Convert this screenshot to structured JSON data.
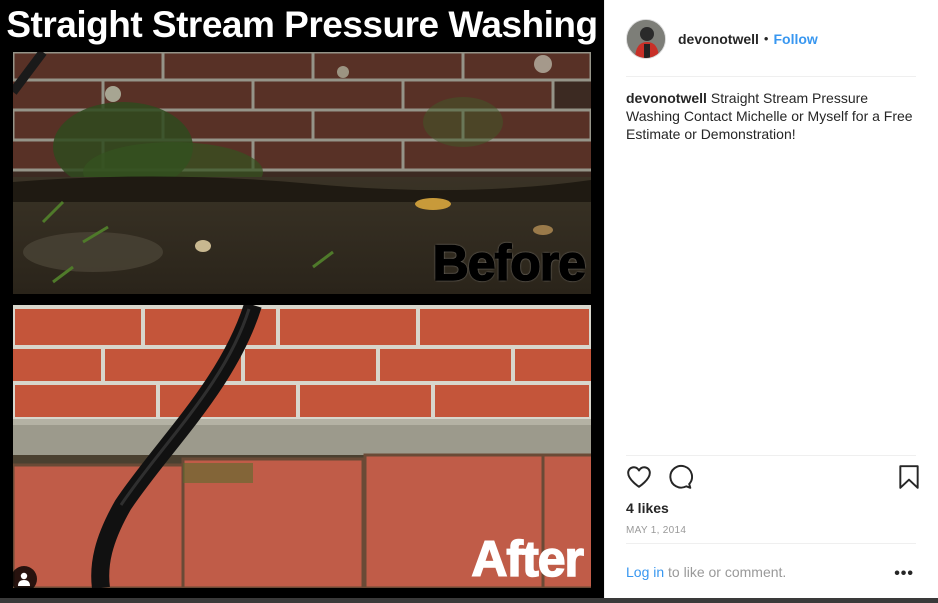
{
  "media": {
    "title": "Straight Stream Pressure Washing",
    "before_label": "Before",
    "after_label": "After",
    "tag_icon": "user-silhouette-icon"
  },
  "author": {
    "username": "devonotwell",
    "separator": "•",
    "follow_label": "Follow"
  },
  "caption": {
    "username": "devonotwell",
    "text": "Straight Stream Pressure Washing Contact Michelle or Myself for a Free Estimate or Demonstration!"
  },
  "actions": {
    "like_icon": "heart-icon",
    "comment_icon": "comment-bubble-icon",
    "save_icon": "bookmark-icon"
  },
  "likes_text": "4 likes",
  "date": "MAY 1, 2014",
  "footer": {
    "login_label": "Log in",
    "rest_text": " to like or comment.",
    "more_label": "•••"
  },
  "colors": {
    "link_blue": "#3897f0",
    "text_dark": "#262626",
    "muted": "#999999"
  }
}
